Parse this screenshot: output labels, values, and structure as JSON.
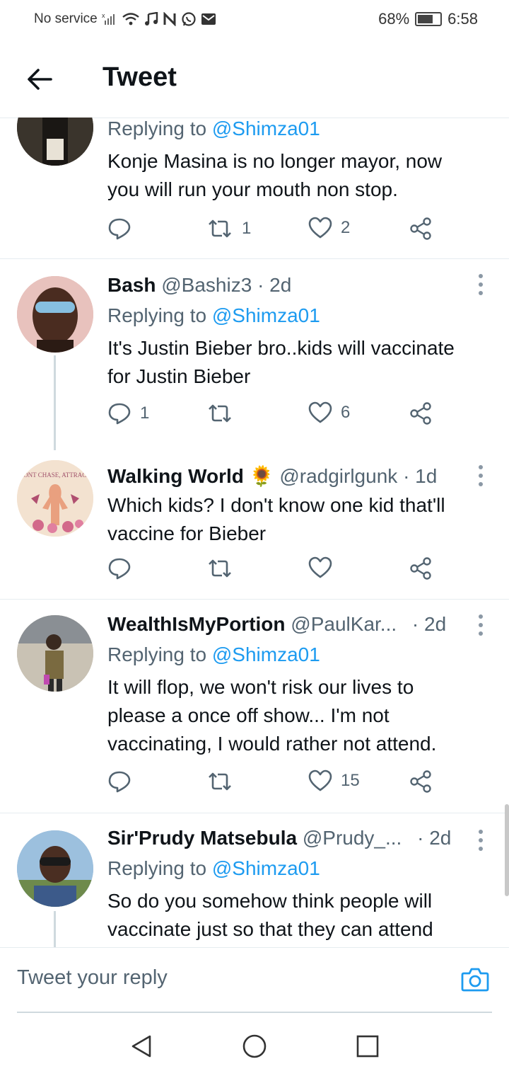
{
  "status_bar": {
    "carrier": "No service",
    "battery": "68%",
    "battery_level": 0.68,
    "time": "6:58",
    "icons": [
      "signal-off-icon",
      "wifi-icon",
      "music-icon",
      "n-icon",
      "whatsapp-icon",
      "mail-icon"
    ]
  },
  "app_bar": {
    "title": "Tweet"
  },
  "tweets": [
    {
      "replying_prefix": "Replying to",
      "replying_to": "@Shimza01",
      "text_lines": [
        "Konje Masina is no longer mayor, now",
        "you will run your mouth non stop."
      ],
      "reply_count": "",
      "retweet_count": "1",
      "like_count": "2"
    },
    {
      "name": "Bash",
      "handle": "@Bashiz3",
      "time": "· 2d",
      "replying_prefix": "Replying to",
      "replying_to": "@Shimza01",
      "text_lines": [
        "It's Justin Bieber bro..kids will vaccinate",
        "for Justin Bieber"
      ],
      "reply_count": "1",
      "retweet_count": "",
      "like_count": "6"
    },
    {
      "name": "Walking World",
      "emoji": "🌻",
      "handle": "@radgirlgunk",
      "time": "· 1d",
      "avatar_text": "DONT CHASE, ATTRACT.",
      "text_lines": [
        "Which kids? I don't know one kid that'll",
        "vaccine for Bieber"
      ],
      "reply_count": "",
      "retweet_count": "",
      "like_count": ""
    },
    {
      "name": "WealthIsMyPortion",
      "handle": "@PaulKar...",
      "time": "· 2d",
      "replying_prefix": "Replying to",
      "replying_to": "@Shimza01",
      "text_lines": [
        "It will flop, we won't risk our lives to",
        "please a once off show... I'm not",
        "vaccinating, I would rather not attend."
      ],
      "reply_count": "",
      "retweet_count": "",
      "like_count": "15"
    },
    {
      "name": "Sir'Prudy Matsebula",
      "handle": "@Prudy_...",
      "time": "· 2d",
      "replying_prefix": "Replying to",
      "replying_to": "@Shimza01",
      "text_lines": [
        "So do you somehow think people will",
        "vaccinate just so that they can attend"
      ]
    }
  ],
  "reply_bar": {
    "placeholder": "Tweet your reply"
  },
  "colors": {
    "accent": "#1d9bf0",
    "muted": "#536471",
    "divider": "#e6ecf0"
  }
}
